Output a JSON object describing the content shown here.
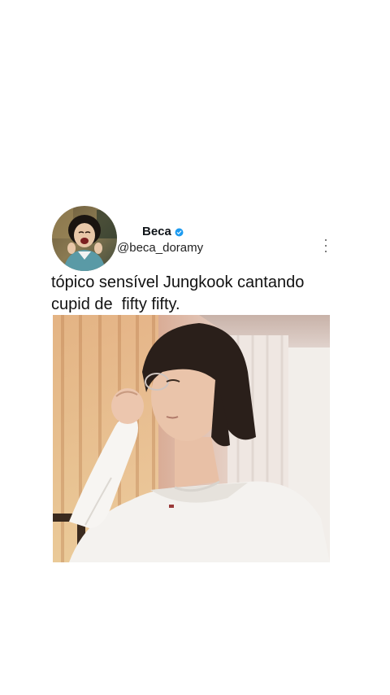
{
  "tweet": {
    "author": {
      "display_name": "Beca",
      "handle": "@beca_doramy",
      "verified": true,
      "avatar_icon": "profile-avatar"
    },
    "text_lines": [
      "tópico sensível Jungkook cantando",
      "cupid de  fifty fifty."
    ],
    "more_icon": "vertical-ellipsis-icon",
    "media": {
      "type": "photo"
    }
  },
  "colors": {
    "background": "#ffffff",
    "verified_badge": "#1d9bf0",
    "text": "#111111"
  }
}
